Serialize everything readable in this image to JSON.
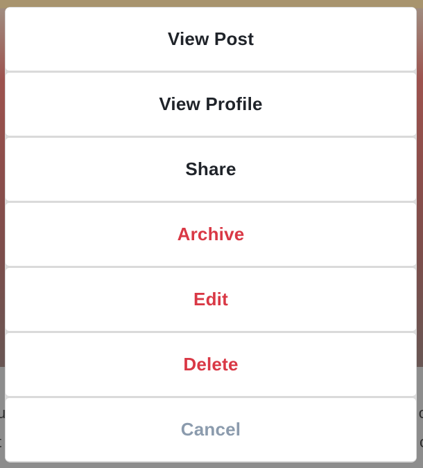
{
  "background": {
    "peek_left": [
      "u",
      "t"
    ],
    "peek_right": [
      "o",
      "c"
    ]
  },
  "colors": {
    "primary_text": "#1f2329",
    "destructive_text": "#d93845",
    "cancel_text": "#8b9bad",
    "sheet_bg": "#ffffff"
  },
  "action_sheet": {
    "items": [
      {
        "label": "View Post",
        "style": "default"
      },
      {
        "label": "View Profile",
        "style": "default"
      },
      {
        "label": "Share",
        "style": "default"
      },
      {
        "label": "Archive",
        "style": "destructive"
      },
      {
        "label": "Edit",
        "style": "destructive"
      },
      {
        "label": "Delete",
        "style": "destructive"
      },
      {
        "label": "Cancel",
        "style": "cancel"
      }
    ]
  }
}
